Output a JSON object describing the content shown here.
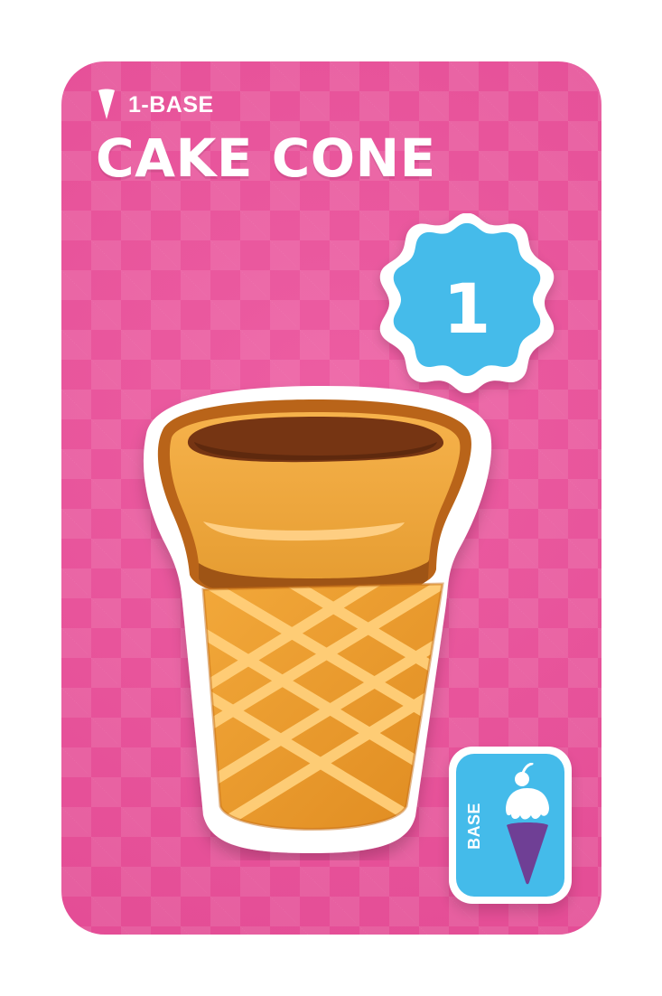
{
  "card": {
    "type_label": "1-BASE",
    "title": "CAKE CONE",
    "badge_value": "1",
    "tag_label": "BASE"
  },
  "icons": {
    "type": "cone-icon",
    "badge": "scalloped-badge-icon",
    "main": "cake-cone-icon",
    "tag": "sundae-cone-icon"
  },
  "colors": {
    "card_pink": "#eb4f9a",
    "badge_blue": "#44bbea",
    "cone_orange": "#f0a83b",
    "cone_brown": "#7a3714",
    "tag_purple": "#6f3f95",
    "white": "#ffffff"
  }
}
